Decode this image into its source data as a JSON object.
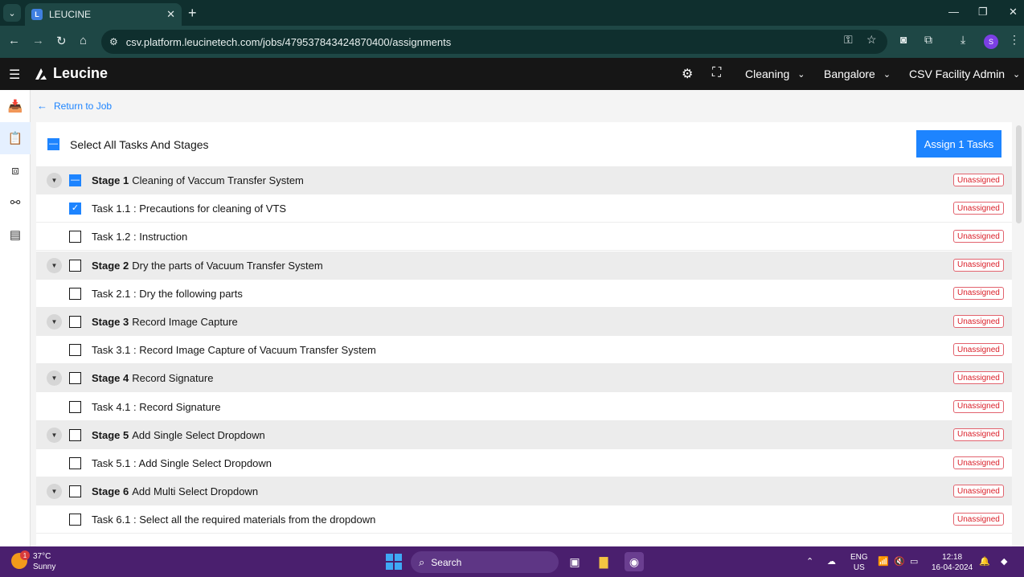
{
  "browser": {
    "tab_title": "LEUCINE",
    "url": "csv.platform.leucinetech.com/jobs/479537843424870400/assignments",
    "profile_initial": "S"
  },
  "header": {
    "brand": "Leucine",
    "dropdowns": [
      "Cleaning",
      "Bangalore",
      "CSV Facility Admin"
    ]
  },
  "page": {
    "return_link": "Return to Job",
    "select_all_label": "Select All Tasks And Stages",
    "assign_button": "Assign 1 Tasks"
  },
  "rows": [
    {
      "type": "stage",
      "prefix": "Stage 1",
      "name": "Cleaning of Vaccum Transfer System",
      "state": "indeterminate",
      "status": "Unassigned"
    },
    {
      "type": "task",
      "prefix": "",
      "name": "Task 1.1 : Precautions for cleaning of VTS",
      "state": "checked",
      "status": "Unassigned"
    },
    {
      "type": "task",
      "prefix": "",
      "name": "Task 1.2 : Instruction",
      "state": "unchecked",
      "status": "Unassigned"
    },
    {
      "type": "stage",
      "prefix": "Stage 2",
      "name": "Dry the parts of Vacuum Transfer System",
      "state": "unchecked",
      "status": "Unassigned"
    },
    {
      "type": "task",
      "prefix": "",
      "name": "Task 2.1 : Dry the following parts",
      "state": "unchecked",
      "status": "Unassigned"
    },
    {
      "type": "stage",
      "prefix": "Stage 3",
      "name": "Record Image Capture",
      "state": "unchecked",
      "status": "Unassigned"
    },
    {
      "type": "task",
      "prefix": "",
      "name": "Task 3.1 : Record Image Capture of Vacuum Transfer System",
      "state": "unchecked",
      "status": "Unassigned"
    },
    {
      "type": "stage",
      "prefix": "Stage 4",
      "name": "Record Signature",
      "state": "unchecked",
      "status": "Unassigned"
    },
    {
      "type": "task",
      "prefix": "",
      "name": "Task 4.1 : Record Signature",
      "state": "unchecked",
      "status": "Unassigned"
    },
    {
      "type": "stage",
      "prefix": "Stage 5",
      "name": "Add Single Select Dropdown",
      "state": "unchecked",
      "status": "Unassigned"
    },
    {
      "type": "task",
      "prefix": "",
      "name": "Task 5.1 : Add Single Select Dropdown",
      "state": "unchecked",
      "status": "Unassigned"
    },
    {
      "type": "stage",
      "prefix": "Stage 6",
      "name": "Add Multi Select Dropdown",
      "state": "unchecked",
      "status": "Unassigned"
    },
    {
      "type": "task",
      "prefix": "",
      "name": "Task 6.1 : Select all the required materials from the dropdown",
      "state": "unchecked",
      "status": "Unassigned"
    }
  ],
  "taskbar": {
    "weather_badge": "1",
    "temperature": "37°C",
    "condition": "Sunny",
    "search_label": "Search",
    "lang_line1": "ENG",
    "lang_line2": "US",
    "time": "12:18",
    "date": "16-04-2024"
  },
  "colors": {
    "primary": "#1d84ff",
    "header_bg": "#161616",
    "badge_red": "#da1e28",
    "taskbar": "#4a1f6e"
  }
}
